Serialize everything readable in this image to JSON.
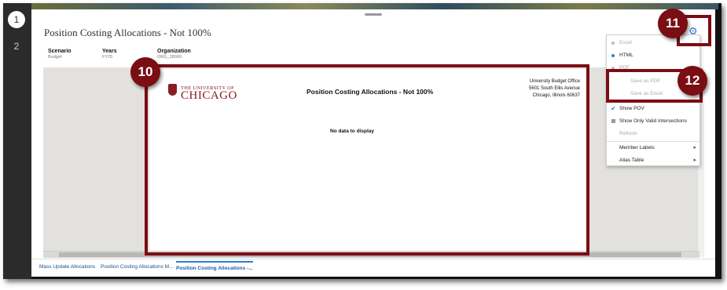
{
  "rail": {
    "steps": [
      "1",
      "2"
    ]
  },
  "header": {
    "title": "Position Costing Allocations - Not 100%"
  },
  "pov": [
    {
      "label": "Scenario",
      "value": "Budget"
    },
    {
      "label": "Years",
      "value": "FY25"
    },
    {
      "label": "Organization",
      "value": "ORG_28000"
    }
  ],
  "report": {
    "logo_top": "THE UNIVERSITY OF",
    "logo_main": "CHICAGO",
    "title": "Position Costing Allocations - Not 100%",
    "address": [
      "University Budget Office",
      "5601 South Ellis Avenue",
      "Chicago, Illinois 60637"
    ],
    "empty_message": "No data to display"
  },
  "menu": {
    "excel": "Excel",
    "html": "HTML",
    "pdf": "PDF",
    "save_pdf": "Save as PDF",
    "save_excel": "Save as Excel",
    "show_pov": "Show POV",
    "show_valid": "Show Only Valid Intersections",
    "refresh": "Refresh",
    "member_labels": "Member Labels",
    "alias_table": "Alias Table"
  },
  "tabs": [
    {
      "label": "Mass Update Allocations"
    },
    {
      "label": "Position Costing Allocations M..."
    },
    {
      "label": "Position Costing Allocations -..."
    }
  ],
  "callouts": {
    "report": "10",
    "gear": "11",
    "save_options": "12"
  },
  "colors": {
    "callout": "#7a0e12",
    "accent": "#2d7bd1",
    "brand": "#8a1c24"
  }
}
